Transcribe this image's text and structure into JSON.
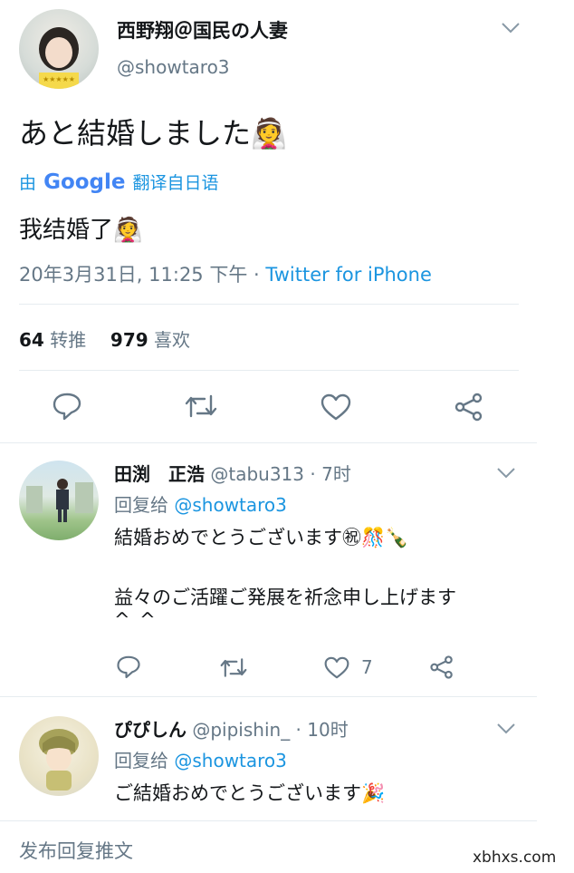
{
  "main_tweet": {
    "author_name": "西野翔＠国民の人妻",
    "handle": "@showtaro3",
    "text": "あと結婚しました👰",
    "translate": {
      "prefix": "由",
      "brand": "Google",
      "suffix": "翻译自日语"
    },
    "translated_text": "我结婚了👰",
    "date": "20年3月31日, 11:25 下午",
    "separator": " · ",
    "source": "Twitter for iPhone",
    "retweets_count": "64",
    "retweets_label": "转推",
    "likes_count": "979",
    "likes_label": "喜欢"
  },
  "replies": [
    {
      "name": "田渕　正浩",
      "handle": "@tabu313",
      "time": " · 7时",
      "reply_prefix": "回复给",
      "reply_to": "@showtaro3",
      "line1": "結婚おめでとうございます㊗🎊🍾",
      "line2": "益々のご活躍ご発展を祈念申し上げます",
      "line3": "^_^",
      "like_count": "7"
    },
    {
      "name": "ぴぴしん",
      "handle": "@pipishin_",
      "time": " · 10时",
      "reply_prefix": "回复给",
      "reply_to": "@showtaro3",
      "line1": "ご結婚おめでとうございます🎉"
    }
  ],
  "compose": {
    "placeholder": "发布回复推文"
  },
  "watermark": "xbhxs.com",
  "colors": {
    "link": "#1b95e0",
    "muted": "#657786",
    "divider": "#e6ecf0"
  }
}
